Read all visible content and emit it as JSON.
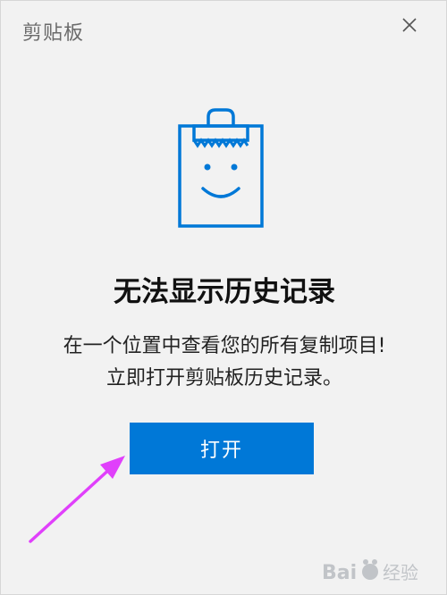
{
  "window": {
    "title": "剪贴板"
  },
  "close_button": {
    "label": "×",
    "icon": "close-icon"
  },
  "illustration": {
    "icon": "clipboard-smiley-icon",
    "color": "#0078d7"
  },
  "empty_state": {
    "heading": "无法显示历史记录",
    "description_line1": "在一个位置中查看您的所有复制项目!",
    "description_line2": "立即打开剪贴板历史记录。"
  },
  "actions": {
    "open_label": "打开",
    "open_color": "#0078d7"
  },
  "annotation": {
    "arrow_color": "#e040fb"
  },
  "watermark": {
    "text": "Baidu 经验"
  }
}
